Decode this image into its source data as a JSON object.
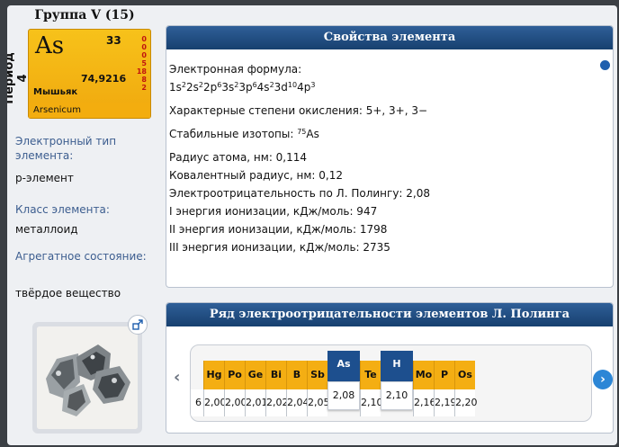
{
  "element": {
    "group_title": "Группа V (15)",
    "period_label": "Период 4",
    "symbol": "As",
    "atomic_number": "33",
    "atomic_mass": "74,9216",
    "electron_shells": [
      "0",
      "0",
      "0",
      "5",
      "18",
      "8",
      "2"
    ],
    "name_ru": "Мышьяк",
    "name_la": "Arsenicum"
  },
  "side_info": {
    "electron_type_label": "Электронный тип элемента:",
    "electron_type_value": "р-элемент",
    "class_label": "Класс элемента:",
    "class_value": "металлоид",
    "state_label": "Агрегатное состояние:",
    "state_value": "твёрдое вещество"
  },
  "props_panel": {
    "title": "Свойства элемента",
    "formula_label": "Электронная формула:",
    "formula_parts": [
      {
        "t": "1s"
      },
      {
        "s": "2"
      },
      {
        "t": "2s"
      },
      {
        "s": "2"
      },
      {
        "t": "2p"
      },
      {
        "s": "6"
      },
      {
        "t": "3s"
      },
      {
        "s": "2"
      },
      {
        "t": "3p"
      },
      {
        "s": "6"
      },
      {
        "t": "4s"
      },
      {
        "s": "2"
      },
      {
        "t": "3d"
      },
      {
        "s": "10"
      },
      {
        "t": "4p"
      },
      {
        "s": "3"
      }
    ],
    "oxidation": "Характерные степени окисления: 5+, 3+, 3−",
    "isotopes_label": "Стабильные изотопы: ",
    "isotope_mass": "75",
    "isotope_symbol": "As",
    "radius": "Радиус атома, нм: 0,114",
    "covalent_radius": "Ковалентный радиус, нм: 0,12",
    "electronegativity": "Электроотрицательность по Л. Полингу: 2,08",
    "ionization_1": "I энергия ионизации, кДж/моль: 947",
    "ionization_2": "II энергия ионизации, кДж/моль: 1798",
    "ionization_3": "III энергия ионизации, кДж/моль: 2735"
  },
  "en_panel": {
    "title": "Ряд электроотрицательности элементов Л. Полинга",
    "partial_value": "6",
    "cells": [
      {
        "symbol": "Hg",
        "value": "2,00",
        "highlight": false
      },
      {
        "symbol": "Po",
        "value": "2,00",
        "highlight": false
      },
      {
        "symbol": "Ge",
        "value": "2,01",
        "highlight": false
      },
      {
        "symbol": "Bi",
        "value": "2,02",
        "highlight": false
      },
      {
        "symbol": "B",
        "value": "2,04",
        "highlight": false
      },
      {
        "symbol": "Sb",
        "value": "2,05",
        "highlight": false
      },
      {
        "symbol": "As",
        "value": "2,08",
        "highlight": true
      },
      {
        "symbol": "Te",
        "value": "2,10",
        "highlight": false
      },
      {
        "symbol": "H",
        "value": "2,10",
        "highlight": true
      },
      {
        "symbol": "Mo",
        "value": "2,16",
        "highlight": false
      },
      {
        "symbol": "P",
        "value": "2,19",
        "highlight": false
      },
      {
        "symbol": "Os",
        "value": "2,20",
        "highlight": false
      }
    ]
  },
  "icons": {
    "expand": "expand-icon",
    "prev": "chevron-left-icon",
    "next": "chevron-right-icon"
  },
  "colors": {
    "header_blue": "#1f4a82",
    "tile_orange": "#f4ae13",
    "highlight_blue": "#1d4f8e",
    "label_blue": "#3c5d8f",
    "next_button": "#2c86d6"
  }
}
